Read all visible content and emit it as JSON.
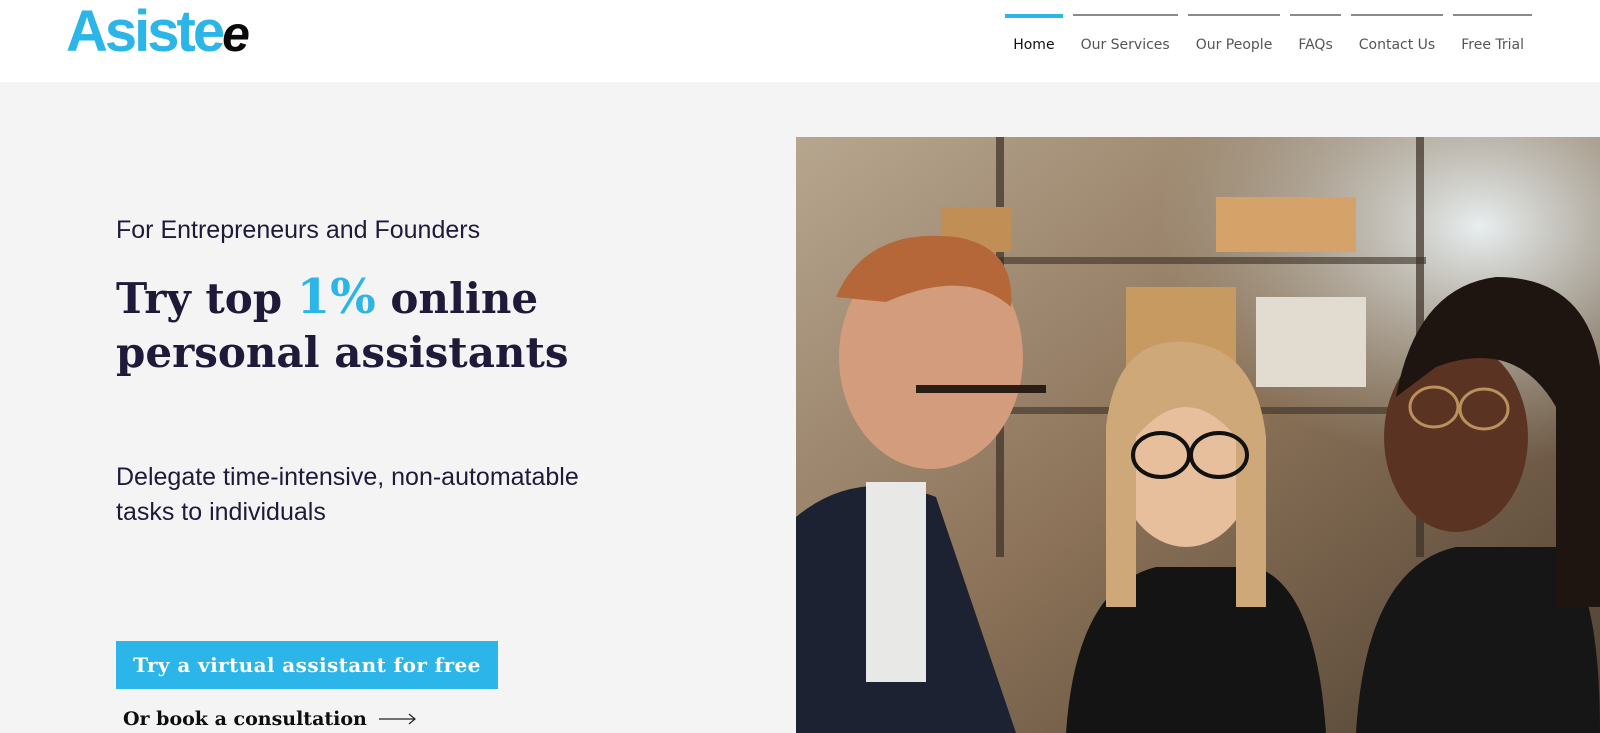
{
  "brand": {
    "logo_main": "Asiste",
    "logo_end": "e",
    "accent_color": "#2bb5e8",
    "text_color": "#1f1a3a"
  },
  "nav": {
    "items": [
      {
        "label": "Home",
        "active": true
      },
      {
        "label": "Our Services",
        "active": false
      },
      {
        "label": "Our People",
        "active": false
      },
      {
        "label": "FAQs",
        "active": false
      },
      {
        "label": "Contact Us",
        "active": false
      },
      {
        "label": "Free Trial",
        "active": false
      }
    ]
  },
  "hero": {
    "eyebrow": "For Entrepreneurs and Founders",
    "headline_pre": "Try top ",
    "headline_accent": "1%",
    "headline_line1_post": " online",
    "headline_line2": "personal assistants",
    "subtext": "Delegate time-intensive, non-automatable tasks to individuals",
    "cta_label": "Try a virtual assistant for free",
    "consult_label": "Or book a consultation",
    "consult_icon": "arrow-right-icon",
    "image_subject": "three smiling colleagues in an office"
  }
}
